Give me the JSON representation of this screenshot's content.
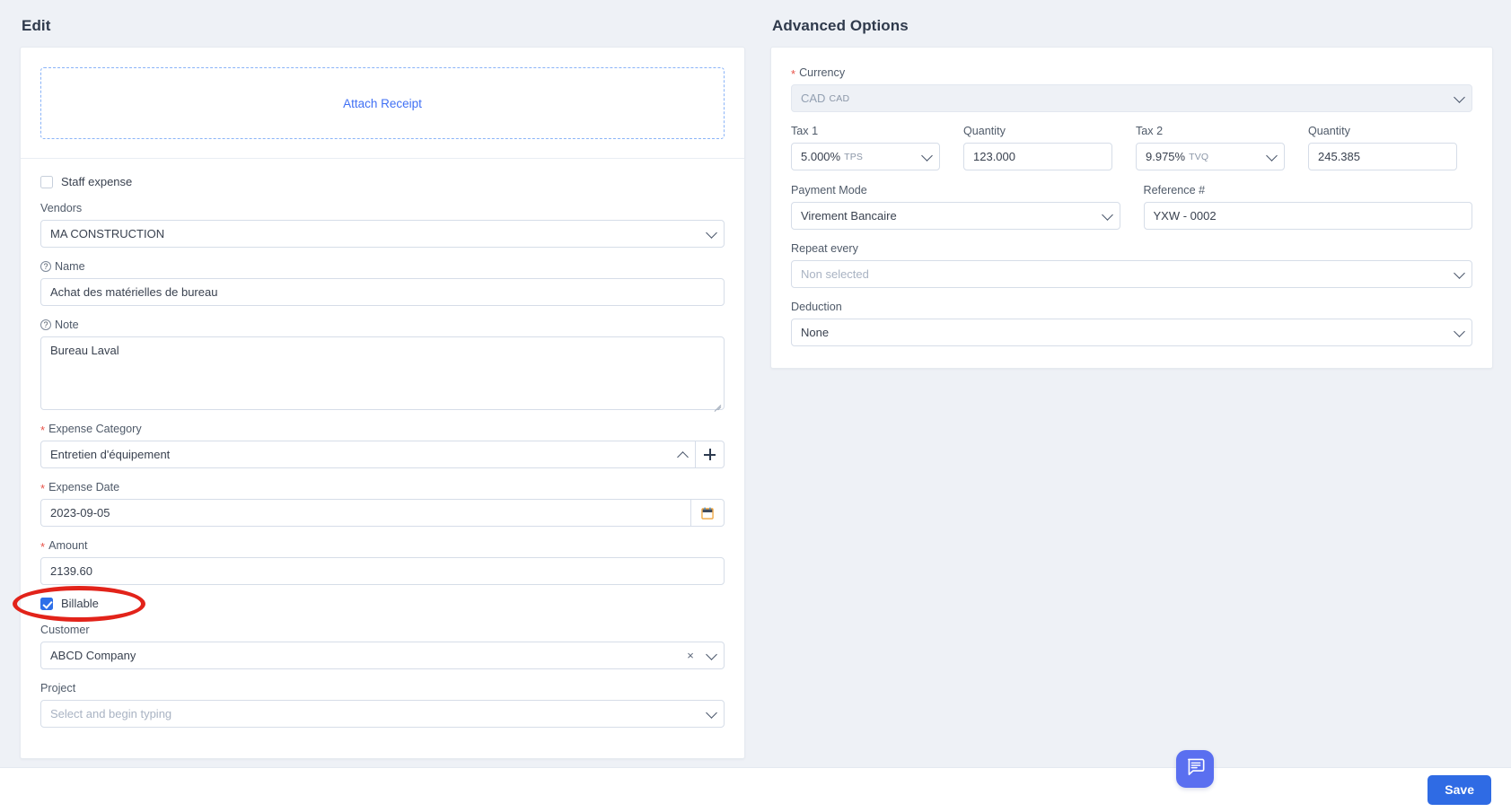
{
  "left": {
    "title": "Edit",
    "attach": {
      "label": "Attach Receipt"
    },
    "staff_expense": {
      "label": "Staff expense",
      "checked": false
    },
    "vendors": {
      "label": "Vendors",
      "value": "MA CONSTRUCTION"
    },
    "name": {
      "label": "Name",
      "value": "Achat des matérielles de bureau",
      "help": "?"
    },
    "note": {
      "label": "Note",
      "value": "Bureau Laval",
      "help": "?"
    },
    "expense_category": {
      "label": "Expense Category",
      "value": "Entretien d'équipement",
      "required": "*",
      "add_label": "+"
    },
    "expense_date": {
      "label": "Expense Date",
      "value": "2023-09-05",
      "required": "*"
    },
    "amount": {
      "label": "Amount",
      "value": "2139.60",
      "required": "*"
    },
    "billable": {
      "label": "Billable",
      "checked": true
    },
    "customer": {
      "label": "Customer",
      "value": "ABCD Company",
      "clear": "×"
    },
    "project": {
      "label": "Project",
      "value": "",
      "placeholder": "Select and begin typing"
    }
  },
  "right": {
    "title": "Advanced Options",
    "currency": {
      "label": "Currency",
      "value": "CAD",
      "suffix": "CAD",
      "required": "*",
      "disabled": true
    },
    "tax1": {
      "label": "Tax 1",
      "value": "5.000%",
      "suffix": "TPS"
    },
    "quantity1": {
      "label": "Quantity",
      "value": "123.000"
    },
    "tax2": {
      "label": "Tax 2",
      "value": "9.975%",
      "suffix": "TVQ"
    },
    "quantity2": {
      "label": "Quantity",
      "value": "245.385"
    },
    "payment_mode": {
      "label": "Payment Mode",
      "value": "Virement Bancaire"
    },
    "reference": {
      "label": "Reference #",
      "value": "YXW - 0002"
    },
    "repeat_every": {
      "label": "Repeat every",
      "value": "",
      "placeholder": "Non selected"
    },
    "deduction": {
      "label": "Deduction",
      "value": "None"
    }
  },
  "footer": {
    "save_label": "Save",
    "chat_icon": "chat-bubble-icon"
  },
  "colors": {
    "page_bg": "#eef1f6",
    "accent_blue": "#2f6be4",
    "link_blue": "#4070f4",
    "chat_purple": "#5a6ff0",
    "annotation_red": "#e2231a",
    "required_red": "#e8544a"
  }
}
